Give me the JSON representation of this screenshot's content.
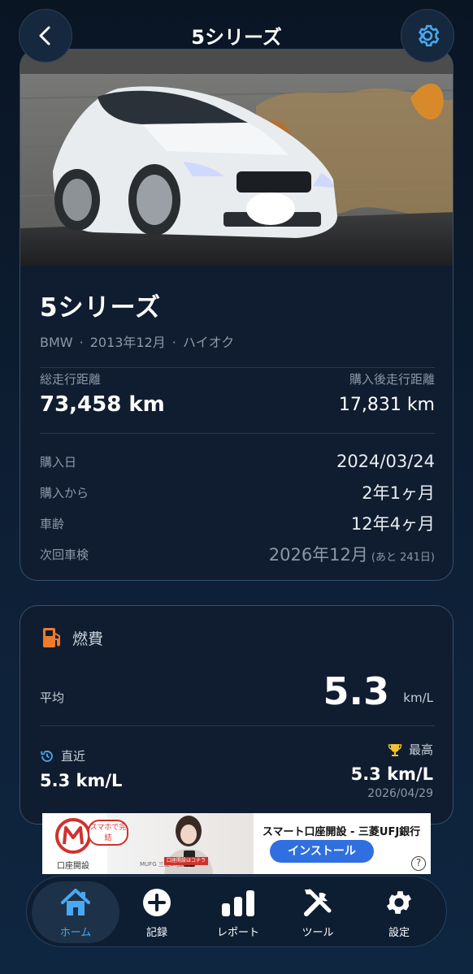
{
  "header": {
    "title": "5シリーズ"
  },
  "car": {
    "name": "5シリーズ",
    "maker": "BMW",
    "date": "2013年12月",
    "fuel_type": "ハイオク",
    "sep": "·",
    "total_label": "総走行距離",
    "total_value": "73,458 km",
    "since_label": "購入後走行距離",
    "since_value": "17,831 km",
    "purchase_date_label": "購入日",
    "purchase_date_value": "2024/03/24",
    "since_purchase_label": "購入から",
    "since_purchase_value": "2年1ヶ月",
    "age_label": "車齢",
    "age_value": "12年4ヶ月",
    "inspection_label": "次回車検",
    "inspection_value": "2026年12月",
    "inspection_note": "(あと 241日)"
  },
  "fuel": {
    "title": "燃費",
    "avg_label": "平均",
    "avg_value": "5.3",
    "avg_unit": "km/L",
    "recent_label": "直近",
    "recent_value": "5.3 km/L",
    "best_label": "最高",
    "best_value": "5.3 km/L",
    "best_date": "2026/04/29"
  },
  "ad": {
    "logo_label": "口座開設",
    "bubble": "スマホで完結",
    "title": "スマート口座開設 - 三菱UFJ銀行",
    "button": "インストール",
    "mini": "MUFG 三菱UFJ銀行",
    "red": "口座開設はコチラ",
    "help": "?"
  },
  "tabs": [
    {
      "label": "ホーム",
      "icon": "home-icon"
    },
    {
      "label": "記録",
      "icon": "plus-circle-icon"
    },
    {
      "label": "レポート",
      "icon": "bar-chart-icon"
    },
    {
      "label": "ツール",
      "icon": "tools-icon"
    },
    {
      "label": "設定",
      "icon": "gear-icon"
    }
  ],
  "colors": {
    "accent": "#4aa8f0",
    "fuel_icon": "#f07a2a",
    "trophy": "#f2c230",
    "card_border": "#33506f"
  }
}
